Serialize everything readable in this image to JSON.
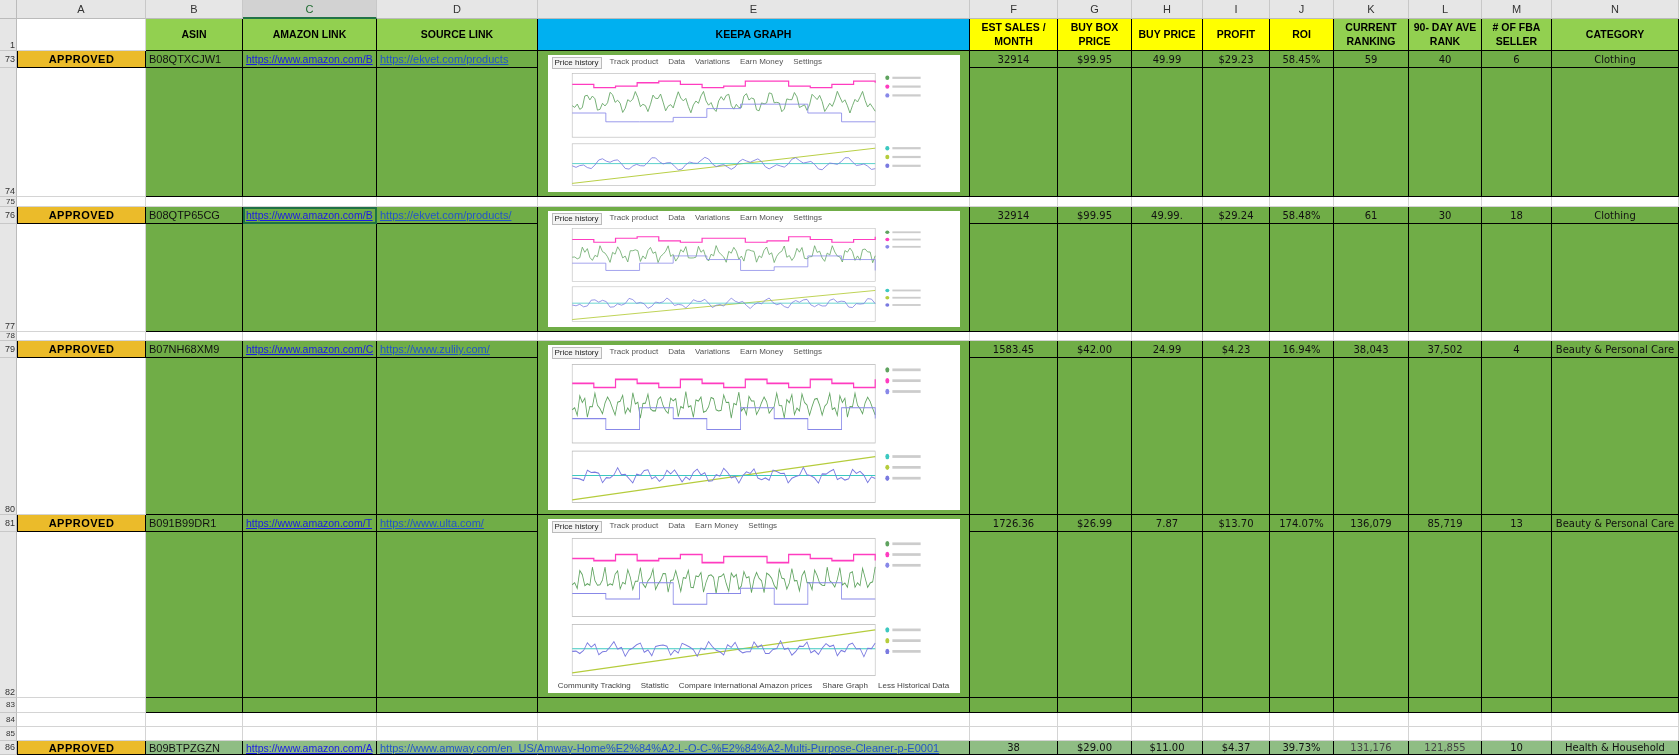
{
  "columns": [
    {
      "letter": "A",
      "selected": false
    },
    {
      "letter": "B",
      "selected": false
    },
    {
      "letter": "C",
      "selected": true
    },
    {
      "letter": "D",
      "selected": false
    },
    {
      "letter": "E",
      "selected": false
    },
    {
      "letter": "F",
      "selected": false
    },
    {
      "letter": "G",
      "selected": false
    },
    {
      "letter": "H",
      "selected": false
    },
    {
      "letter": "I",
      "selected": false
    },
    {
      "letter": "J",
      "selected": false
    },
    {
      "letter": "K",
      "selected": false
    },
    {
      "letter": "L",
      "selected": false
    },
    {
      "letter": "M",
      "selected": false
    },
    {
      "letter": "N",
      "selected": false
    }
  ],
  "header_row": {
    "row_number": "1",
    "cells": [
      {
        "label": "ASIN",
        "color": "#92d050"
      },
      {
        "label": "AMAZON LINK",
        "color": "#92d050"
      },
      {
        "label": "SOURCE LINK",
        "color": "#92d050"
      },
      {
        "label": "KEEPA GRAPH",
        "color": "#00b0f0"
      },
      {
        "label": "EST SALES / MONTH",
        "color": "#ffff00"
      },
      {
        "label": "BUY BOX PRICE",
        "color": "#ffff00"
      },
      {
        "label": "BUY PRICE",
        "color": "#ffff00"
      },
      {
        "label": "PROFIT",
        "color": "#ffff00"
      },
      {
        "label": "ROI",
        "color": "#ffff00"
      },
      {
        "label": "CURRENT RANKING",
        "color": "#92d050"
      },
      {
        "label": "90- DAY AVE RANK",
        "color": "#92d050"
      },
      {
        "label": "# OF FBA SELLER",
        "color": "#92d050"
      },
      {
        "label": "CATEGORY",
        "color": "#92d050"
      }
    ]
  },
  "rows": [
    {
      "kind": "product",
      "row_number": "73",
      "detail_row_number": "74",
      "status": "APPROVED",
      "asin": "B08QTXCJW1",
      "amazon_link": "https://www.amazon.com/B",
      "amazon_link_selected": false,
      "source_link": "https://ekvet.com/products",
      "graph": {
        "tabs": [
          {
            "label": "Price history",
            "selected": true
          },
          {
            "label": "Track product",
            "selected": false
          },
          {
            "label": "Data",
            "selected": false
          },
          {
            "label": "Variations",
            "selected": false
          },
          {
            "label": "Earn Money",
            "selected": false
          },
          {
            "label": "Settings",
            "selected": false
          }
        ]
      },
      "values": [
        "32914",
        "$99.95",
        "49.99",
        "$29.23",
        "58.45%",
        "59",
        "40",
        "6",
        "Clothing"
      ]
    },
    {
      "kind": "spacer",
      "row_number": "75",
      "color": "#ffffff"
    },
    {
      "kind": "product",
      "row_number": "76",
      "detail_row_number": "77",
      "status": "APPROVED",
      "asin": "B08QTP65CG",
      "amazon_link": "https://www.amazon.com/B",
      "amazon_link_selected": true,
      "source_link": "https://ekvet.com/products/",
      "graph": {
        "tabs": [
          {
            "label": "Price history",
            "selected": true
          },
          {
            "label": "Track product",
            "selected": false
          },
          {
            "label": "Data",
            "selected": false
          },
          {
            "label": "Variations",
            "selected": false
          },
          {
            "label": "Earn Money",
            "selected": false
          },
          {
            "label": "Settings",
            "selected": false
          }
        ]
      },
      "values": [
        "32914",
        "$99.95",
        "49.99.",
        "$29.24",
        "58.48%",
        "61",
        "30",
        "18",
        "Clothing"
      ]
    },
    {
      "kind": "spacer",
      "row_number": "78",
      "color": "#ffffff"
    },
    {
      "kind": "product",
      "row_number": "79",
      "detail_row_number": "80",
      "status": "APPROVED",
      "asin": "B07NH68XM9",
      "amazon_link": "https://www.amazon.com/C",
      "amazon_link_selected": false,
      "source_link": "https://www.zulily.com/",
      "graph": {
        "tabs": [
          {
            "label": "Price history",
            "selected": true
          },
          {
            "label": "Track product",
            "selected": false
          },
          {
            "label": "Data",
            "selected": false
          },
          {
            "label": "Variations",
            "selected": false
          },
          {
            "label": "Earn Money",
            "selected": false
          },
          {
            "label": "Settings",
            "selected": false
          }
        ]
      },
      "values": [
        "1583.45",
        "$42.00",
        "24.99",
        "$4.23",
        "16.94%",
        "38,043",
        "37,502",
        "4",
        "Beauty & Personal Care"
      ]
    },
    {
      "kind": "product",
      "row_number": "81",
      "detail_row_number": "82",
      "status": "APPROVED",
      "asin": "B091B99DR1",
      "amazon_link": "https://www.amazon.com/T",
      "amazon_link_selected": false,
      "source_link": "https://www.ulta.com/",
      "graph": {
        "tabs": [
          {
            "label": "Price history",
            "selected": true
          },
          {
            "label": "Track product",
            "selected": false
          },
          {
            "label": "Data",
            "selected": false
          },
          {
            "label": "Earn Money",
            "selected": false
          },
          {
            "label": "Settings",
            "selected": false
          }
        ],
        "footer": [
          "Community Tracking",
          "Statistic",
          "Compare international Amazon prices",
          "Share Graph",
          "Less Historical Data"
        ]
      },
      "values": [
        "1726.36",
        "$26.99",
        "7.87",
        "$13.70",
        "174.07%",
        "136,079",
        "85,719",
        "13",
        "Beauty & Personal Care"
      ]
    },
    {
      "kind": "spacer",
      "row_number": "83",
      "color": "#70ad47"
    },
    {
      "kind": "spacer",
      "row_number": "84",
      "color": "#ffffff"
    },
    {
      "kind": "spacer",
      "row_number": "85",
      "color": "#ffffff"
    },
    {
      "kind": "product",
      "row_number": "86",
      "status": "APPROVED",
      "asin": "B09BTPZGZN",
      "amazon_link": "https://www.amazon.com/A",
      "amazon_link_selected": false,
      "source_link": "https://www.amway.com/en_US/Amway-Home%E2%84%A2-L-O-C-%E2%84%A2-Multi-Purpose-Cleaner-p-E0001",
      "values": [
        "38",
        "$29.00",
        "$11.00",
        "$4.37",
        "39.73%",
        "131,176",
        "121,855",
        "10",
        "Health & Household"
      ]
    }
  ]
}
